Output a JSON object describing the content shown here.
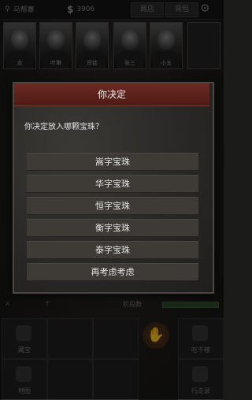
{
  "topbar": {
    "location": "马帮寨",
    "currency_symbol": "$",
    "money": "3906",
    "btn_shop": "商店",
    "btn_bag": "背包"
  },
  "portraits": [
    {
      "name": "龙"
    },
    {
      "name": "叶琳"
    },
    {
      "name": "司徒"
    },
    {
      "name": "张三"
    },
    {
      "name": "小五"
    },
    {
      "name": ""
    }
  ],
  "dialog": {
    "title": "你决定",
    "prompt": "你决定放入哪颗宝珠？",
    "options": [
      "嵩字宝珠",
      "华字宝珠",
      "恒字宝珠",
      "衡字宝珠",
      "泰字宝珠",
      "再考虑考虑"
    ]
  },
  "status": {
    "left": "",
    "mid": "",
    "right": "阶段数"
  },
  "grid": {
    "c1": "藏宝",
    "c2": "",
    "c3": "",
    "c4": "吃干粮",
    "c5": "地图",
    "c6": "",
    "c7": "",
    "c8": "行走录"
  }
}
